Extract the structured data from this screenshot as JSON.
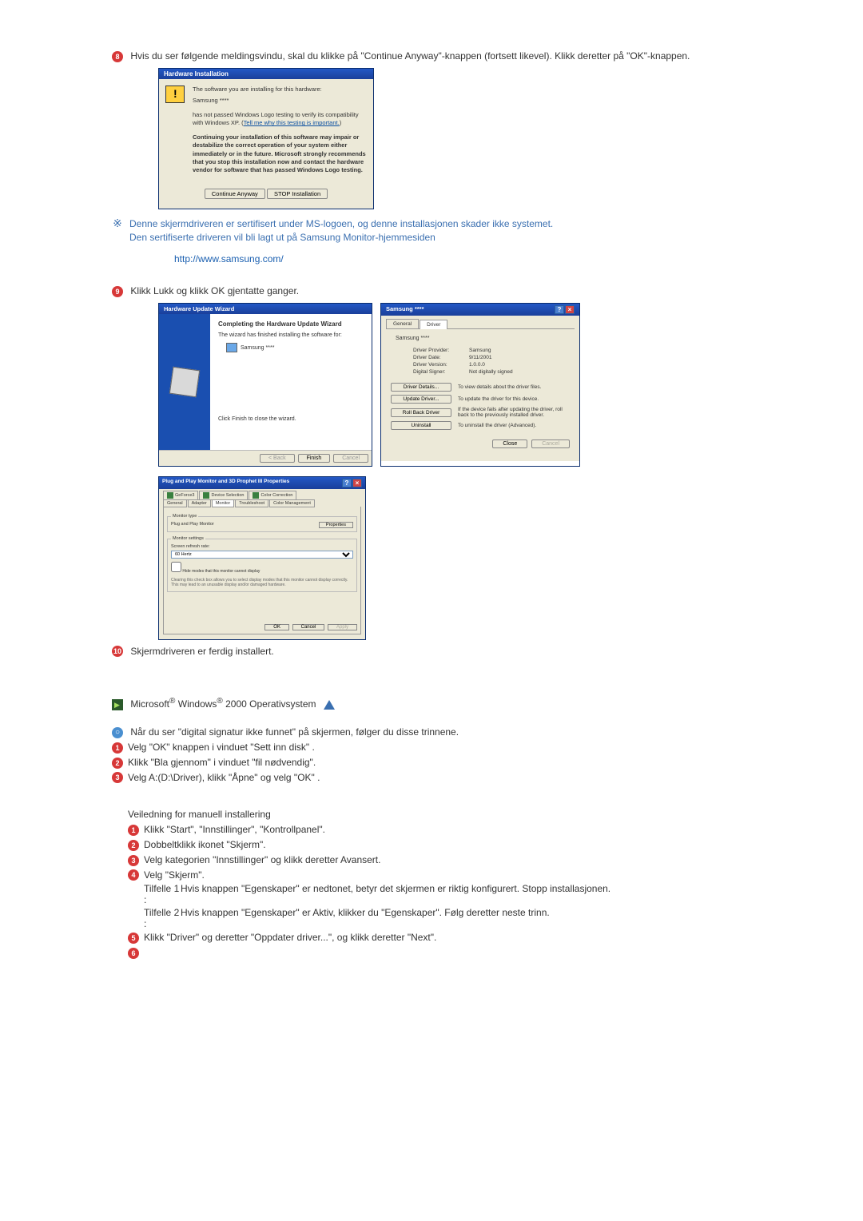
{
  "steps": {
    "s8_text": "Hvis du ser følgende meldingsvindu, skal du klikke på \"Continue Anyway\"-knappen (fortsett likevel). Klikk deretter på \"OK\"-knappen.",
    "note1": "Denne skjermdriveren er sertifisert under MS-logoen, og denne installasjonen skader ikke systemet.",
    "note2": "Den sertifiserte driveren vil bli lagt ut på Samsung Monitor-hjemmesiden",
    "note_url": "http://www.samsung.com/",
    "s9_text": "Klikk Lukk og klikk OK gjentatte ganger.",
    "s10_text": "Skjermdriveren er ferdig installert."
  },
  "hw_dialog": {
    "title": "Hardware Installation",
    "line1": "The software you are installing for this hardware:",
    "device": "Samsung ****",
    "line2a": "has not passed Windows Logo testing to verify its compatibility with Windows XP. (",
    "line2_link": "Tell me why this testing is important.",
    "line2b": ")",
    "warn": "Continuing your installation of this software may impair or destabilize the correct operation of your system either immediately or in the future. Microsoft strongly recommends that you stop this installation now and contact the hardware vendor for software that has passed Windows Logo testing.",
    "btn_continue": "Continue Anyway",
    "btn_stop": "STOP Installation"
  },
  "wizard": {
    "title": "Hardware Update Wizard",
    "heading": "Completing the Hardware Update Wizard",
    "line1": "The wizard has finished installing the software for:",
    "device": "Samsung ****",
    "line2": "Click Finish to close the wizard.",
    "btn_back": "< Back",
    "btn_finish": "Finish",
    "btn_cancel": "Cancel"
  },
  "props": {
    "title": "Samsung ****",
    "tab_general": "General",
    "tab_driver": "Driver",
    "device": "Samsung ****",
    "provider_k": "Driver Provider:",
    "provider_v": "Samsung",
    "date_k": "Driver Date:",
    "date_v": "9/11/2001",
    "version_k": "Driver Version:",
    "version_v": "1.0.0.0",
    "signer_k": "Digital Signer:",
    "signer_v": "Not digitally signed",
    "btn_details": "Driver Details...",
    "btn_details_d": "To view details about the driver files.",
    "btn_update": "Update Driver...",
    "btn_update_d": "To update the driver for this device.",
    "btn_rollback": "Roll Back Driver",
    "btn_rollback_d": "If the device fails after updating the driver, roll back to the previously installed driver.",
    "btn_uninstall": "Uninstall",
    "btn_uninstall_d": "To uninstall the driver (Advanced).",
    "btn_close": "Close",
    "btn_cancel": "Cancel"
  },
  "monprops": {
    "title": "Plug and Play Monitor and 3D Prophet III Properties",
    "tabs_r1": [
      "GeForce3",
      "Device Selection",
      "Color Correction"
    ],
    "tabs_r2": [
      "General",
      "Adapter",
      "Monitor",
      "Troubleshoot",
      "Color Management"
    ],
    "fs1": "Monitor type",
    "montype": "Plug and Play Monitor",
    "btn_props": "Properties",
    "fs2": "Monitor settings",
    "refresh_lbl": "Screen refresh rate:",
    "refresh_val": "60 Hertz",
    "chk_hide": "Hide modes that this monitor cannot display",
    "chk_note": "Clearing this check box allows you to select display modes that this monitor cannot display correctly. This may lead to an unusable display and/or damaged hardware.",
    "btn_ok": "OK",
    "btn_cancel": "Cancel",
    "btn_apply": "Apply"
  },
  "win2000": {
    "heading_pre": "Microsoft",
    "heading_mid": " Windows",
    "heading_post": " 2000 Operativsystem",
    "sig_intro": "Når du ser \"digital signatur ikke funnet\" på skjermen, følger du disse trinnene.",
    "sig1": "Velg \"OK\" knappen i vinduet \"Sett inn disk\" .",
    "sig2": "Klikk \"Bla gjennom\" i vinduet \"fil nødvendig\".",
    "sig3": "Velg A:(D:\\Driver), klikk \"Åpne\" og velg \"OK\" .",
    "manual_h": "Veiledning for manuell installering",
    "m1": "Klikk \"Start\", \"Innstillinger\", \"Kontrollpanel\".",
    "m2": "Dobbeltklikk ikonet \"Skjerm\".",
    "m3": "Velg kategorien \"Innstillinger\" og klikk deretter Avansert.",
    "m4": "Velg \"Skjerm\".",
    "case1_l": "Tilfelle 1 :",
    "case1": "Hvis knappen \"Egenskaper\" er nedtonet, betyr det skjermen er riktig konfigurert. Stopp installasjonen.",
    "case2_l": "Tilfelle 2 :",
    "case2": "Hvis knappen \"Egenskaper\" er Aktiv, klikker du \"Egenskaper\". Følg deretter neste trinn.",
    "m5": "Klikk \"Driver\" og deretter \"Oppdater driver...\", og klikk deretter \"Next\"."
  },
  "nums": {
    "n1": "1",
    "n2": "2",
    "n3": "3",
    "n4": "4",
    "n5": "5",
    "n6": "6",
    "n8": "8",
    "n9": "9",
    "n10": "10"
  }
}
